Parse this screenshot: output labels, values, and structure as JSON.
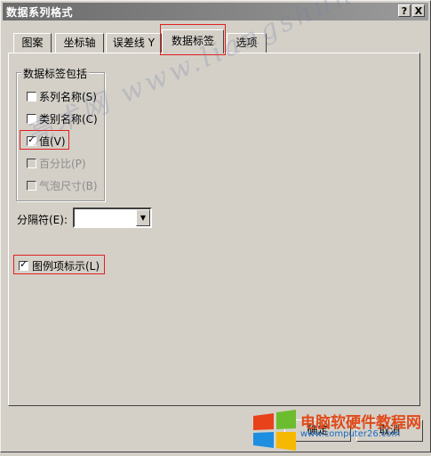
{
  "dialog": {
    "title": "数据系列格式"
  },
  "titlebar_buttons": {
    "help": "?",
    "close": "X"
  },
  "tabs": [
    {
      "label": "图案"
    },
    {
      "label": "坐标轴"
    },
    {
      "label": "误差线 Y"
    },
    {
      "label": "数据标签"
    },
    {
      "label": "选项"
    }
  ],
  "active_tab": "数据标签",
  "group": {
    "title": "数据标签包括",
    "options": [
      {
        "label": "系列名称(S)",
        "checked": false,
        "enabled": true
      },
      {
        "label": "类别名称(C)",
        "checked": false,
        "enabled": true
      },
      {
        "label": "值(V)",
        "checked": true,
        "enabled": true
      },
      {
        "label": "百分比(P)",
        "checked": false,
        "enabled": false
      },
      {
        "label": "气泡尺寸(B)",
        "checked": false,
        "enabled": false
      }
    ]
  },
  "separator": {
    "label": "分隔符(E):",
    "value": ""
  },
  "legend_key": {
    "label": "图例项标示(L)",
    "checked": true
  },
  "buttons": {
    "ok": "确定",
    "cancel": "取消"
  },
  "watermark": "亮术网 www.liangshunet.com",
  "site": {
    "name": "电脑软硬件教程网",
    "url": "www.computer26.com"
  }
}
